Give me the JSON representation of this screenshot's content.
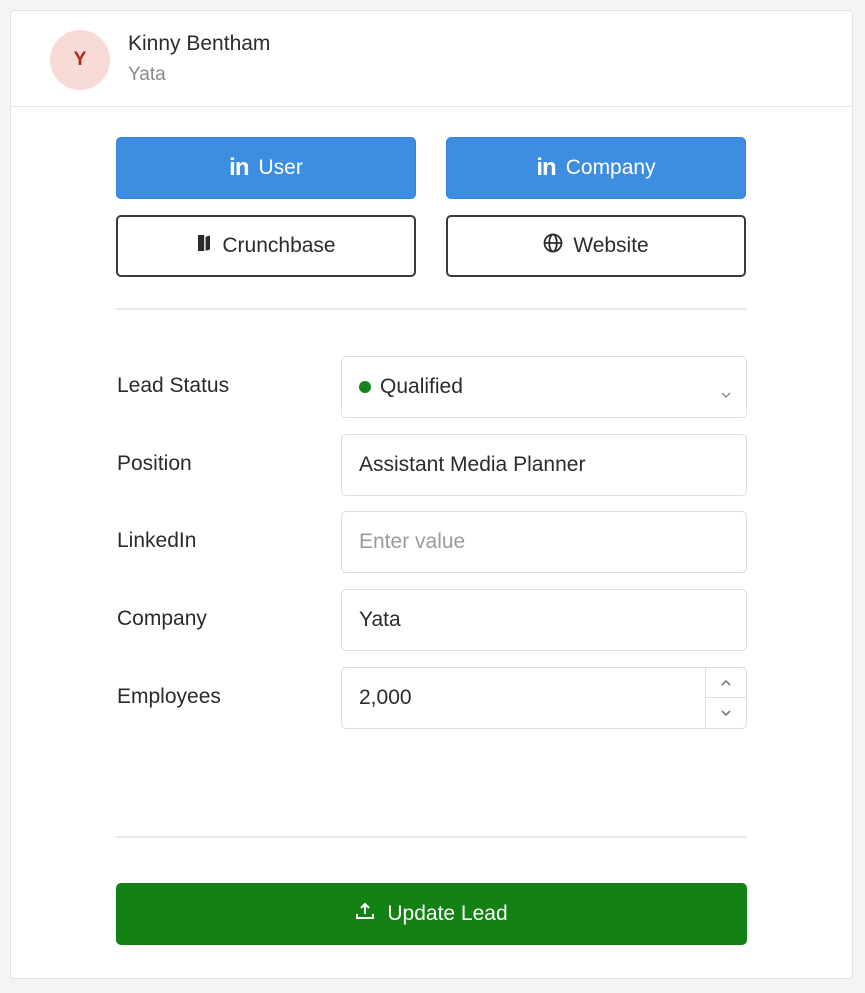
{
  "header": {
    "avatar_initial": "Y",
    "name": "Kinny Bentham",
    "company": "Yata"
  },
  "links": {
    "linkedin_user_label": "User",
    "linkedin_company_label": "Company",
    "crunchbase_label": "Crunchbase",
    "website_label": "Website",
    "linkedin_icon_text": "in"
  },
  "form": {
    "lead_status": {
      "label": "Lead Status",
      "value": "Qualified",
      "status_color": "#16831d"
    },
    "position": {
      "label": "Position",
      "value": "Assistant Media Planner"
    },
    "linkedin": {
      "label": "LinkedIn",
      "value": "",
      "placeholder": "Enter value"
    },
    "company": {
      "label": "Company",
      "value": "Yata"
    },
    "employees": {
      "label": "Employees",
      "value": "2,000"
    }
  },
  "actions": {
    "update_label": "Update Lead"
  },
  "colors": {
    "primary_blue": "#3d8ee0",
    "success_green": "#138114",
    "avatar_bg": "#f8dad6",
    "avatar_text": "#b3261e"
  },
  "icons": {
    "linkedin": "linkedin-icon",
    "crunchbase": "crunchbase-icon",
    "website": "globe-icon",
    "update": "upload-icon",
    "select": "chevron-down-icon"
  }
}
